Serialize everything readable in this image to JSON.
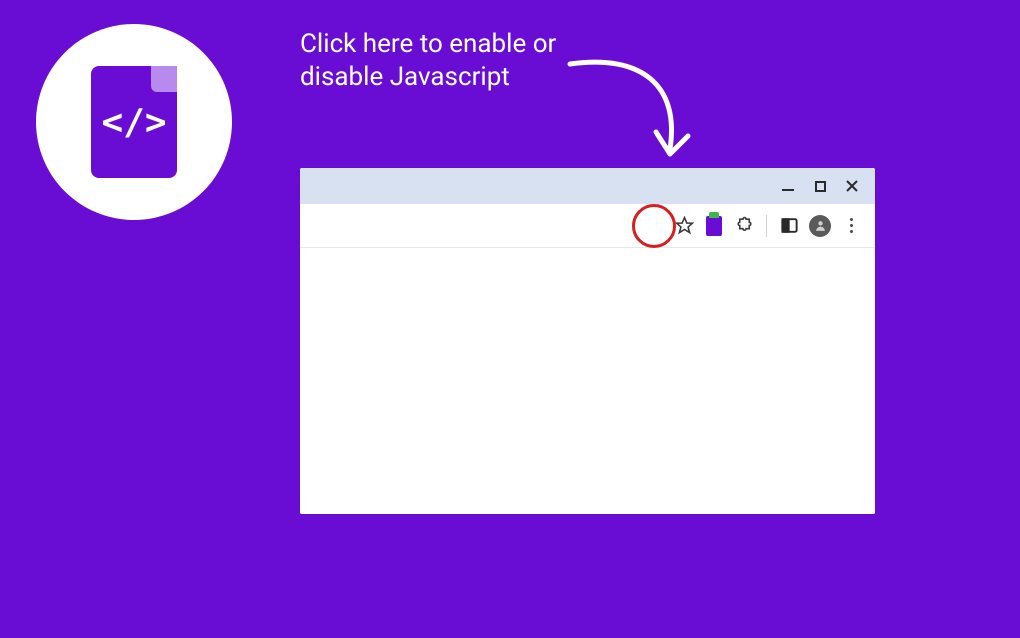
{
  "logo": {
    "code_glyph": "</>"
  },
  "caption": {
    "text": "Click here to enable or disable Javascript"
  },
  "browser": {
    "window_controls": {
      "minimize": "minimize",
      "maximize": "maximize",
      "close": "close"
    },
    "toolbar": {
      "star": "bookmark",
      "extension": "js-toggle-extension",
      "puzzle": "extensions",
      "panel": "side-panel",
      "avatar": "profile",
      "menu": "menu"
    }
  }
}
